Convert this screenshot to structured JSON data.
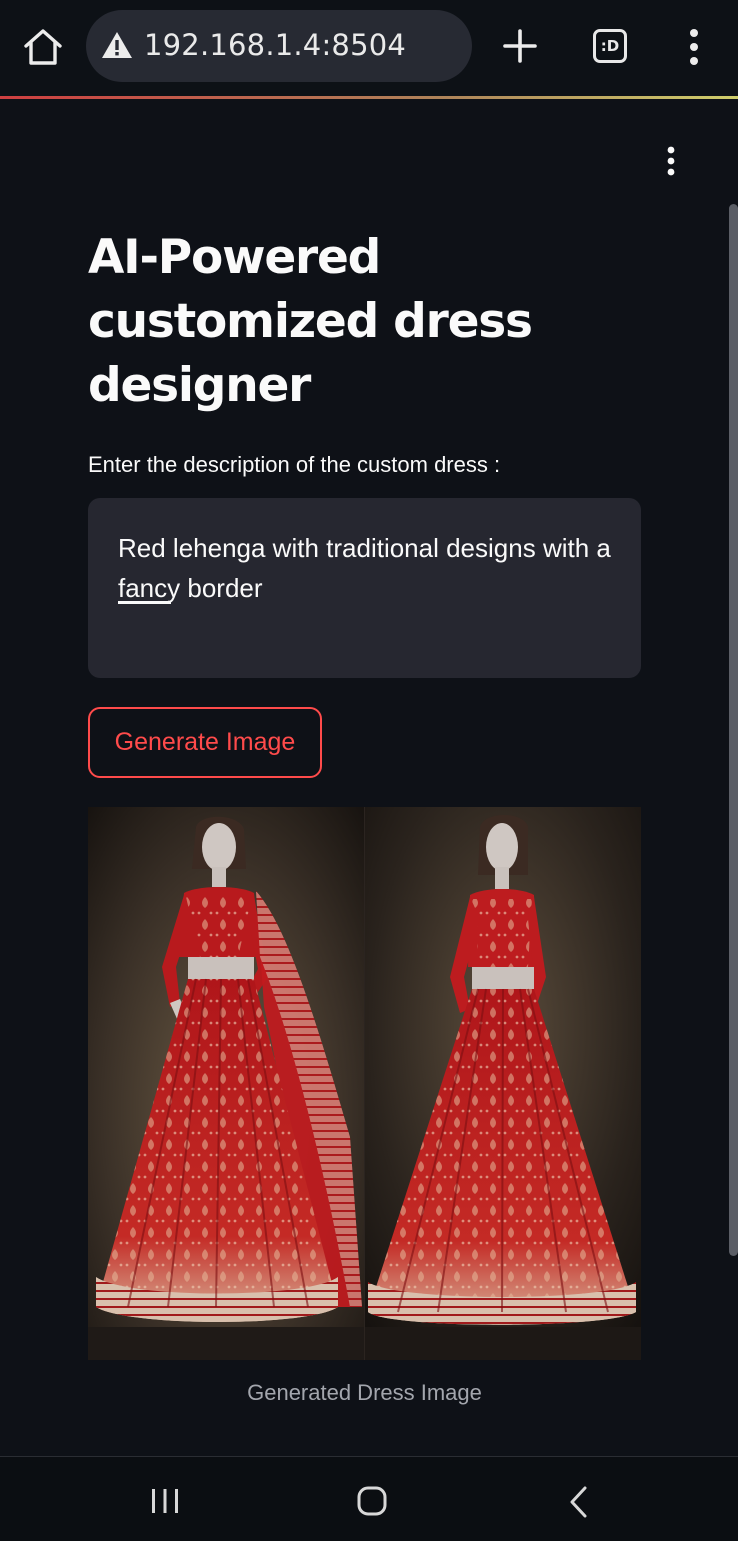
{
  "browser": {
    "url": "192.168.1.4:8504",
    "tabs_badge": ":D",
    "icons": [
      "home-icon",
      "warning-icon",
      "plus-icon",
      "tab-switcher-icon",
      "more-vert-icon"
    ]
  },
  "app": {
    "title": "AI-Powered customized dress designer",
    "field_label": "Enter the description of the custom dress :",
    "description_value": "Red lehenga with traditional designs with a fancy border",
    "generate_button": "Generate Image",
    "image_caption": "Generated Dress Image",
    "accent_color": "#ff4b4b",
    "menu_icon": "more-vert-icon"
  },
  "navbar": {
    "icons": [
      "recent-apps-icon",
      "home-circle-icon",
      "back-icon"
    ]
  }
}
